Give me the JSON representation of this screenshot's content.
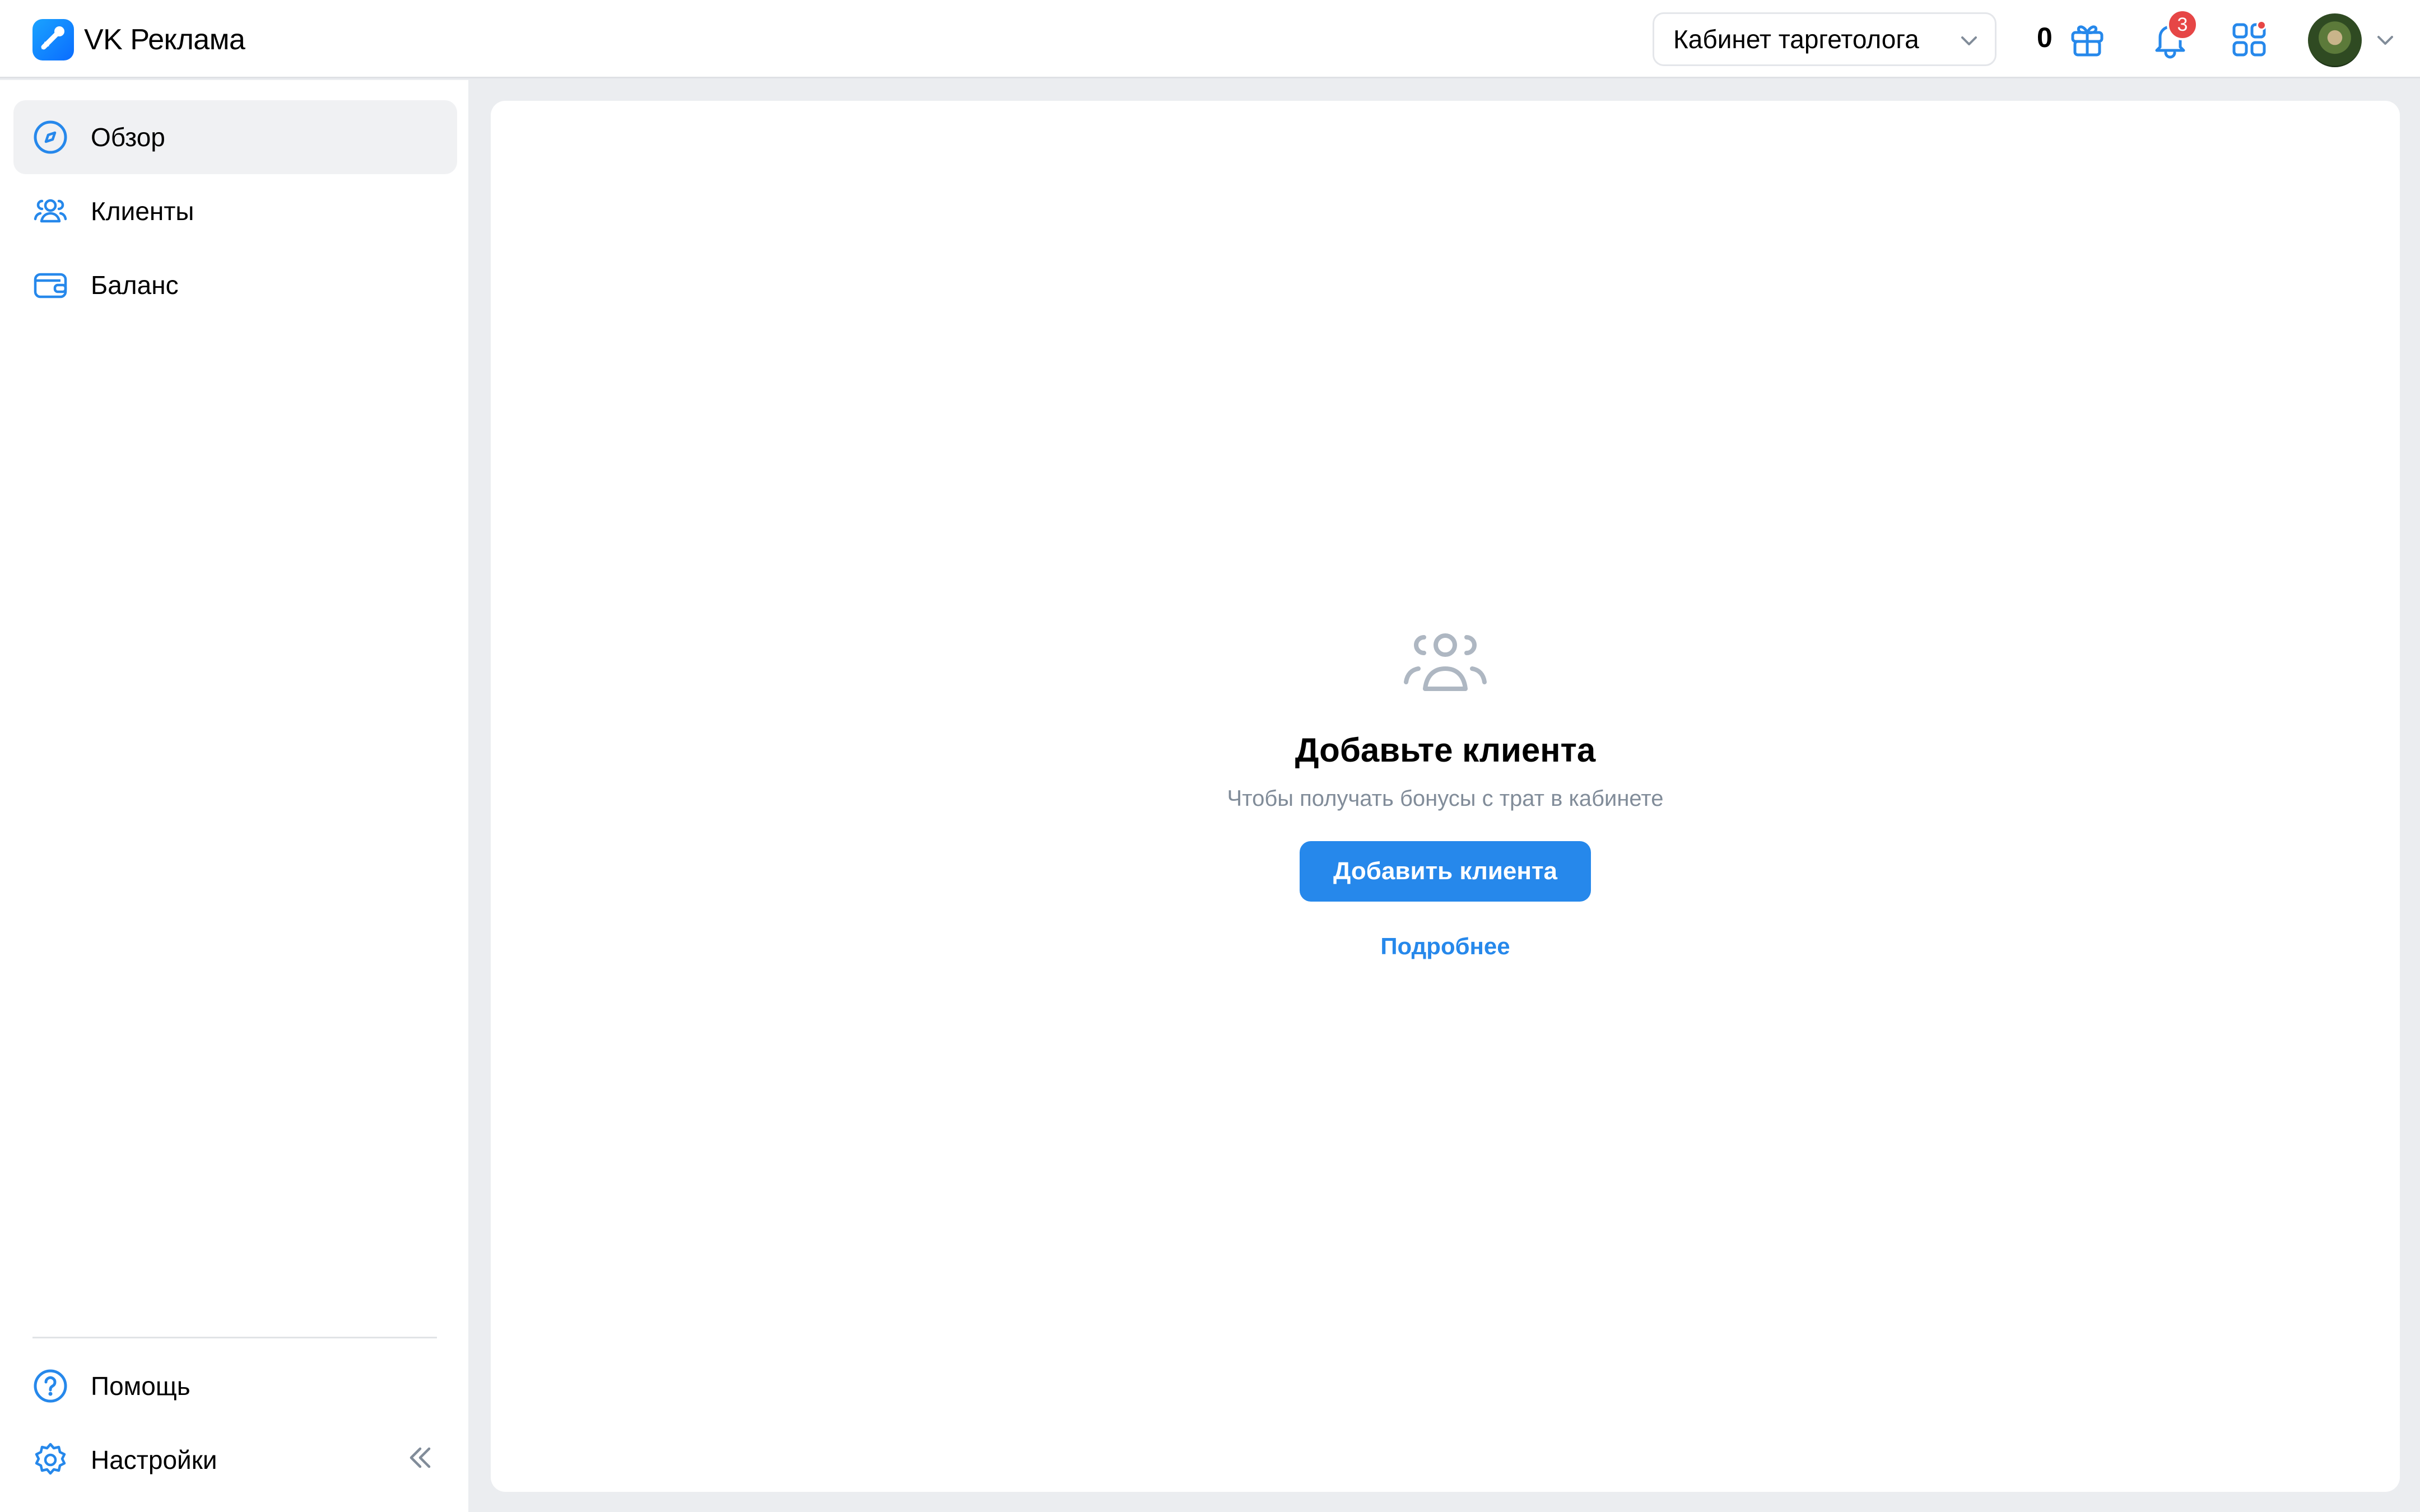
{
  "header": {
    "app_title": "VK Реклама",
    "cabinet_select": {
      "value": "Кабинет таргетолога"
    },
    "bonus_count": "0",
    "notifications_badge": "3"
  },
  "sidebar": {
    "items": [
      {
        "label": "Обзор",
        "icon": "compass-icon",
        "active": true
      },
      {
        "label": "Клиенты",
        "icon": "users-icon"
      },
      {
        "label": "Баланс",
        "icon": "wallet-icon"
      }
    ],
    "bottom_items": [
      {
        "label": "Помощь",
        "icon": "help-icon"
      },
      {
        "label": "Настройки",
        "icon": "gear-icon"
      }
    ]
  },
  "main": {
    "empty_state": {
      "icon": "users-icon",
      "title": "Добавьте клиента",
      "subtitle": "Чтобы получать бонусы с трат в кабинете",
      "button_label": "Добавить клиента",
      "link_label": "Подробнее"
    }
  },
  "colors": {
    "accent": "#2688eb",
    "badge": "#e64646",
    "icon_blue": "#2688eb",
    "muted_text": "#818c99",
    "page_bg": "#ebedf0"
  }
}
